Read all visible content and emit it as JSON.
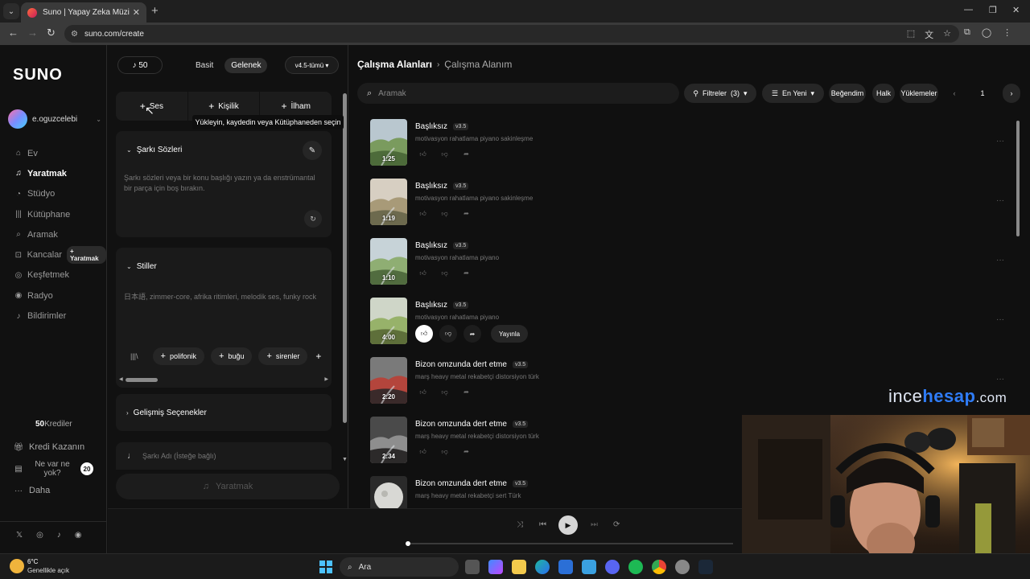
{
  "browser": {
    "tab_title": "Suno | Yapay Zeka Müziği",
    "url": "suno.com/create"
  },
  "sidebar": {
    "logo": "SUNO",
    "user": "e.oguzcelebi",
    "nav": [
      {
        "label": "Ev",
        "icon": "home-icon"
      },
      {
        "label": "Yaratmak",
        "icon": "music-note-icon",
        "active": true
      },
      {
        "label": "Stüdyo",
        "icon": "studio-icon"
      },
      {
        "label": "Kütüphane",
        "icon": "library-icon"
      },
      {
        "label": "Aramak",
        "icon": "search-icon"
      },
      {
        "label": "Kancalar",
        "icon": "hook-icon",
        "badge": "+ Yaratmak"
      },
      {
        "label": "Keşfetmek",
        "icon": "compass-icon"
      },
      {
        "label": "Radyo",
        "icon": "radio-icon"
      },
      {
        "label": "Bildirimler",
        "icon": "bell-icon"
      }
    ],
    "credits_value": "50",
    "credits_label": "Krediler",
    "earn": "Kredi Kazanın",
    "news": "Ne var ne yok?",
    "news_count": "20",
    "more": "Daha"
  },
  "create": {
    "credits": "♪ 50",
    "mode_basic": "Basit",
    "mode_custom": "Gelenek",
    "version": "v4.5-tümü ▾",
    "tooltip": "Yükleyin, kaydedin veya Kütüphaneden seçin",
    "seg": [
      "Ses",
      "Kişilik",
      "İlham"
    ],
    "lyrics_title": "Şarkı Sözleri",
    "lyrics_placeholder": "Şarkı sözleri veya bir konu başlığı yazın ya da enstrümantal bir parça için boş bırakın.",
    "styles_title": "Stiller",
    "styles_placeholder": "日本語, zimmer-core, afrika ritimleri, melodik ses, funky rock",
    "tags": [
      "polifonik",
      "buğu",
      "sirenler"
    ],
    "advanced": "Gelişmiş Seçenekler",
    "song_title_placeholder": "Şarkı Adı (İsteğe bağlı)",
    "create_button": "Yaratmak"
  },
  "workspace": {
    "crumb_root": "Çalışma Alanları",
    "crumb_current": "Çalışma Alanım",
    "search_placeholder": "Aramak",
    "filters": "Filtreler",
    "filters_count": "(3)",
    "sort": "En Yeni",
    "liked": "Beğendim",
    "public": "Halk",
    "uploads": "Yüklemeler",
    "page": "1",
    "publish_label": "Yayınla",
    "songs": [
      {
        "title": "Başlıksız",
        "version": "v3.5",
        "style": "motivasyon rahatlama piyano sakinleşme",
        "duration": "1:25",
        "palette": "meadow"
      },
      {
        "title": "Başlıksız",
        "version": "v3.5",
        "style": "motivasyon rahatlama piyano sakinleşme",
        "duration": "1:19",
        "palette": "river"
      },
      {
        "title": "Başlıksız",
        "version": "v3.5",
        "style": "motivasyon rahatlama piyano",
        "duration": "1:10",
        "palette": "valley"
      },
      {
        "title": "Başlıksız",
        "version": "v3.5",
        "style": "motivasyon rahatlama piyano",
        "duration": "4:00",
        "palette": "stream",
        "liked": true
      },
      {
        "title": "Bizon omzunda dert etme",
        "version": "v3.5",
        "style": "marş heavy metal rekabetçi distorsiyon türk",
        "duration": "2:20",
        "palette": "red"
      },
      {
        "title": "Bizon omzunda dert etme",
        "version": "v3.5",
        "style": "marş heavy metal rekabetçi distorsiyon türk",
        "duration": "2:34",
        "palette": "storm"
      },
      {
        "title": "Bizon omzunda dert etme",
        "version": "v3.5",
        "style": "marş heavy metal rekabetçi sert Türk",
        "duration": "",
        "palette": "moon"
      }
    ]
  },
  "watermark": {
    "a": "ince",
    "b": "hesap",
    "c": ".com"
  },
  "player": {
    "progress": 0.0
  },
  "taskbar": {
    "temp": "6°C",
    "weather": "Genellikle açık",
    "search": "Ara"
  },
  "colors": {
    "accent": "#2f7cf6",
    "background": "#101010",
    "panel": "#1a1a1a"
  }
}
